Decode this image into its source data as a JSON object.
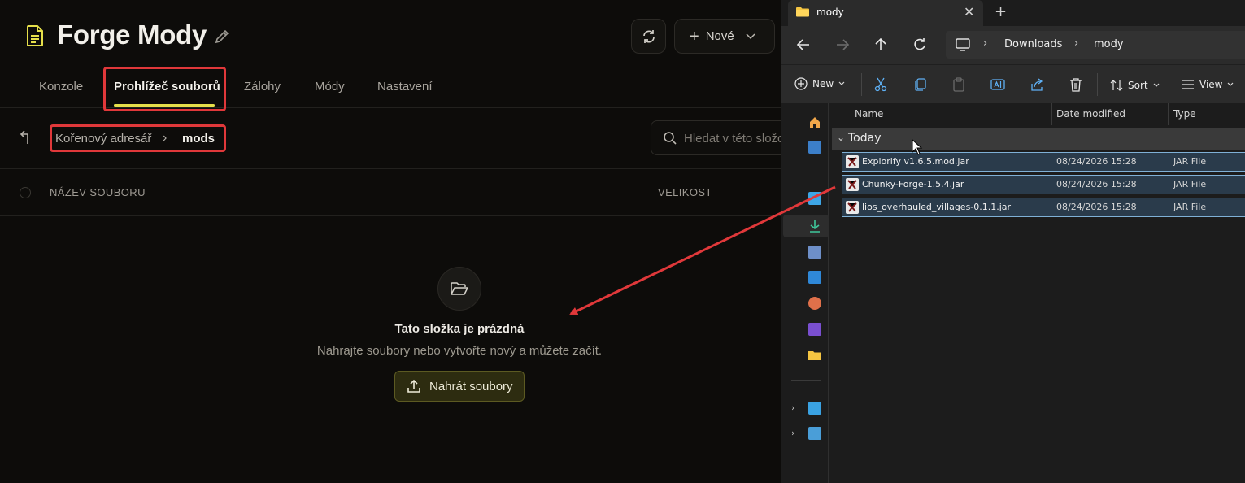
{
  "app": {
    "title": "Forge Mody",
    "new_button": "Nové",
    "tabs": [
      "Konzole",
      "Prohlížeč souborů",
      "Zálohy",
      "Módy",
      "Nastavení"
    ],
    "breadcrumb": {
      "root": "Kořenový adresář",
      "separator": "›",
      "current": "mods"
    },
    "search_placeholder": "Hledat v této složce",
    "columns": {
      "name": "NÁZEV SOUBORU",
      "size": "VELIKOST"
    },
    "empty": {
      "title": "Tato složka je prázdná",
      "subtitle": "Nahrajte soubory nebo vytvořte nový a můžete začít.",
      "upload_button": "Nahrát soubory"
    },
    "accent_color": "#e5df4a",
    "highlight_color": "#e0383a"
  },
  "explorer": {
    "tab_title": "mody",
    "close_glyph": "✕",
    "new_tab_glyph": "+",
    "address": {
      "segment1": "Downloads",
      "segment2": "mody",
      "separator": "›"
    },
    "toolbar": {
      "new": "New",
      "sort": "Sort",
      "view": "View"
    },
    "columns": {
      "name": "Name",
      "date": "Date modified",
      "type": "Type"
    },
    "group": "Today",
    "files": [
      {
        "name": "Explorify v1.6.5.mod.jar",
        "date": "08/24/2026 15:28",
        "type": "JAR File"
      },
      {
        "name": "Chunky-Forge-1.5.4.jar",
        "date": "08/24/2026 15:28",
        "type": "JAR File"
      },
      {
        "name": "lios_overhauled_villages-0.1.1.jar",
        "date": "08/24/2026 15:28",
        "type": "JAR File"
      }
    ]
  }
}
